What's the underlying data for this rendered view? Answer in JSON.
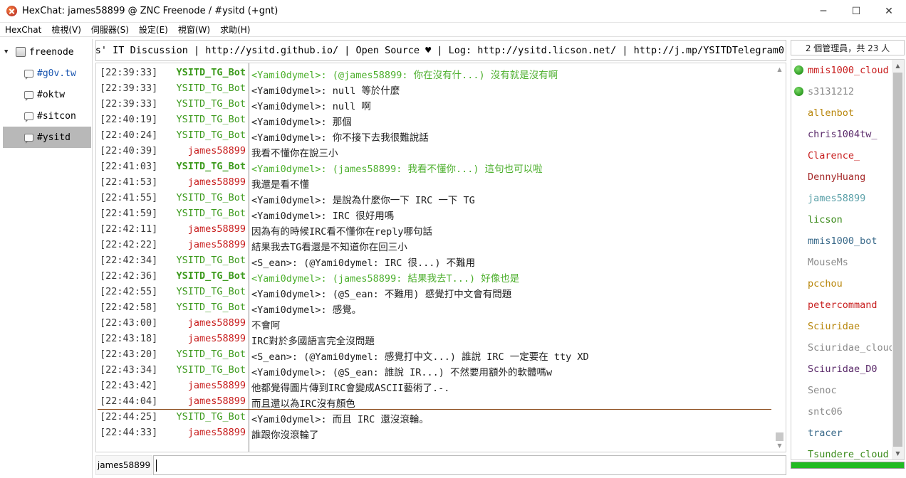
{
  "window": {
    "title": "HexChat: james58899 @ ZNC Freenode / #ysitd (+gnt)",
    "minimize": "─",
    "maximize": "☐",
    "close": "✕"
  },
  "menu": [
    "HexChat",
    "檢視(V)",
    "伺服器(S)",
    "設定(E)",
    "視窗(W)",
    "求助(H)"
  ],
  "tree": {
    "server": "freenode",
    "channels": [
      "#g0v.tw",
      "#oktw",
      "#sitcon",
      "#ysitd"
    ],
    "selected": "#ysitd",
    "expander": "▼"
  },
  "topic": "ts' IT Discussion | http://ysitd.github.io/ | Open Source ♥ | Log: http://ysitd.licson.net/ | http://j.mp/YSITDTelegram0",
  "colors": {
    "bot": "#3c9a1c",
    "user": "#c81e1e",
    "highlight": "#4caf2c",
    "marker": "#8b4a1a",
    "lag": "#22bb22"
  },
  "messages": [
    {
      "time": "[22:39:33]",
      "nick": "YSITD_TG_Bot",
      "text": "<Yami0dymel>: (@james58899: 你在沒有什...) 沒有就是沒有啊",
      "kind": "highlight"
    },
    {
      "time": "[22:39:33]",
      "nick": "YSITD_TG_Bot",
      "text": "<Yami0dymel>: null 等於什麼",
      "kind": "bot"
    },
    {
      "time": "[22:39:33]",
      "nick": "YSITD_TG_Bot",
      "text": "<Yami0dymel>: null 啊",
      "kind": "bot"
    },
    {
      "time": "[22:40:19]",
      "nick": "YSITD_TG_Bot",
      "text": "<Yami0dymel>: 那個",
      "kind": "bot"
    },
    {
      "time": "[22:40:24]",
      "nick": "YSITD_TG_Bot",
      "text": "<Yami0dymel>: 你不接下去我很難說話",
      "kind": "bot"
    },
    {
      "time": "[22:40:39]",
      "nick": "james58899",
      "text": "我看不懂你在說三小",
      "kind": "user"
    },
    {
      "time": "[22:41:03]",
      "nick": "YSITD_TG_Bot",
      "text": "<Yami0dymel>: (james58899: 我看不懂你...) 這句也可以啦",
      "kind": "highlight"
    },
    {
      "time": "[22:41:53]",
      "nick": "james58899",
      "text": "我還是看不懂",
      "kind": "user"
    },
    {
      "time": "[22:41:55]",
      "nick": "YSITD_TG_Bot",
      "text": "<Yami0dymel>: 是說為什麼你一下 IRC 一下 TG",
      "kind": "bot"
    },
    {
      "time": "[22:41:59]",
      "nick": "YSITD_TG_Bot",
      "text": "<Yami0dymel>: IRC 很好用嗎",
      "kind": "bot"
    },
    {
      "time": "[22:42:11]",
      "nick": "james58899",
      "text": "因為有的時候IRC看不懂你在reply哪句話",
      "kind": "user"
    },
    {
      "time": "[22:42:22]",
      "nick": "james58899",
      "text": "結果我去TG看還是不知道你在回三小",
      "kind": "user"
    },
    {
      "time": "[22:42:34]",
      "nick": "YSITD_TG_Bot",
      "text": "<S_ean>: (@Yami0dymel: IRC 很...) 不難用",
      "kind": "bot"
    },
    {
      "time": "[22:42:36]",
      "nick": "YSITD_TG_Bot",
      "text": "<Yami0dymel>: (james58899: 結果我去T...) 好像也是",
      "kind": "highlight"
    },
    {
      "time": "[22:42:55]",
      "nick": "YSITD_TG_Bot",
      "text": "<Yami0dymel>: (@S_ean: 不難用) 感覺打中文會有問題",
      "kind": "bot"
    },
    {
      "time": "[22:42:58]",
      "nick": "YSITD_TG_Bot",
      "text": "<Yami0dymel>: 感覺。",
      "kind": "bot"
    },
    {
      "time": "[22:43:00]",
      "nick": "james58899",
      "text": "不會阿",
      "kind": "user"
    },
    {
      "time": "[22:43:18]",
      "nick": "james58899",
      "text": "IRC對於多國語言完全沒問題",
      "kind": "user"
    },
    {
      "time": "[22:43:20]",
      "nick": "YSITD_TG_Bot",
      "text": "<S_ean>: (@Yami0dymel: 感覺打中文...) 誰說 IRC 一定要在 tty XD",
      "kind": "bot"
    },
    {
      "time": "[22:43:34]",
      "nick": "YSITD_TG_Bot",
      "text": "<Yami0dymel>: (@S_ean: 誰說 IR...) 不然要用額外的軟體嗎w",
      "kind": "bot"
    },
    {
      "time": "[22:43:42]",
      "nick": "james58899",
      "text": "他都覺得圖片傳到IRC會變成ASCII藝術了.-.",
      "kind": "user"
    },
    {
      "time": "[22:44:04]",
      "nick": "james58899",
      "text": "而且還以為IRC沒有顏色",
      "kind": "user"
    },
    {
      "time": "[22:44:25]",
      "nick": "YSITD_TG_Bot",
      "text": "<Yami0dymel>: 而且 IRC 還沒滾輪。",
      "kind": "bot"
    },
    {
      "time": "[22:44:33]",
      "nick": "james58899",
      "text": "誰跟你沒滾輪了",
      "kind": "user"
    }
  ],
  "input": {
    "nick": "james58899",
    "value": ""
  },
  "users": {
    "count_label": "2 個管理員，共 23 人",
    "list": [
      {
        "name": "mmis1000_cloud",
        "op": true,
        "color": "#c81e1e"
      },
      {
        "name": "s3131212",
        "op": true,
        "color": "#8a8a8a"
      },
      {
        "name": "allenbot",
        "op": false,
        "color": "#b8860b"
      },
      {
        "name": "chris1004tw_",
        "op": false,
        "color": "#5a2a6a"
      },
      {
        "name": "Clarence_",
        "op": false,
        "color": "#c81e1e"
      },
      {
        "name": "DennyHuang",
        "op": false,
        "color": "#a52a2a"
      },
      {
        "name": "james58899",
        "op": false,
        "color": "#5aa0a8"
      },
      {
        "name": "licson",
        "op": false,
        "color": "#3a8a1a"
      },
      {
        "name": "mmis1000_bot",
        "op": false,
        "color": "#3a6a8a"
      },
      {
        "name": "MouseMs",
        "op": false,
        "color": "#8a8a8a"
      },
      {
        "name": "pcchou",
        "op": false,
        "color": "#b8860b"
      },
      {
        "name": "petercommand",
        "op": false,
        "color": "#c81e1e"
      },
      {
        "name": "Sciuridae",
        "op": false,
        "color": "#b8860b"
      },
      {
        "name": "Sciuridae_cloud",
        "op": false,
        "color": "#8a8a8a"
      },
      {
        "name": "Sciuridae_D0",
        "op": false,
        "color": "#5a2a6a"
      },
      {
        "name": "Senoc",
        "op": false,
        "color": "#8a8a8a"
      },
      {
        "name": "sntc06",
        "op": false,
        "color": "#8a8a8a"
      },
      {
        "name": "tracer",
        "op": false,
        "color": "#3a6a8a"
      },
      {
        "name": "Tsundere_cloud",
        "op": false,
        "color": "#3a8a1a"
      }
    ],
    "lag_fraction": 1.0
  }
}
